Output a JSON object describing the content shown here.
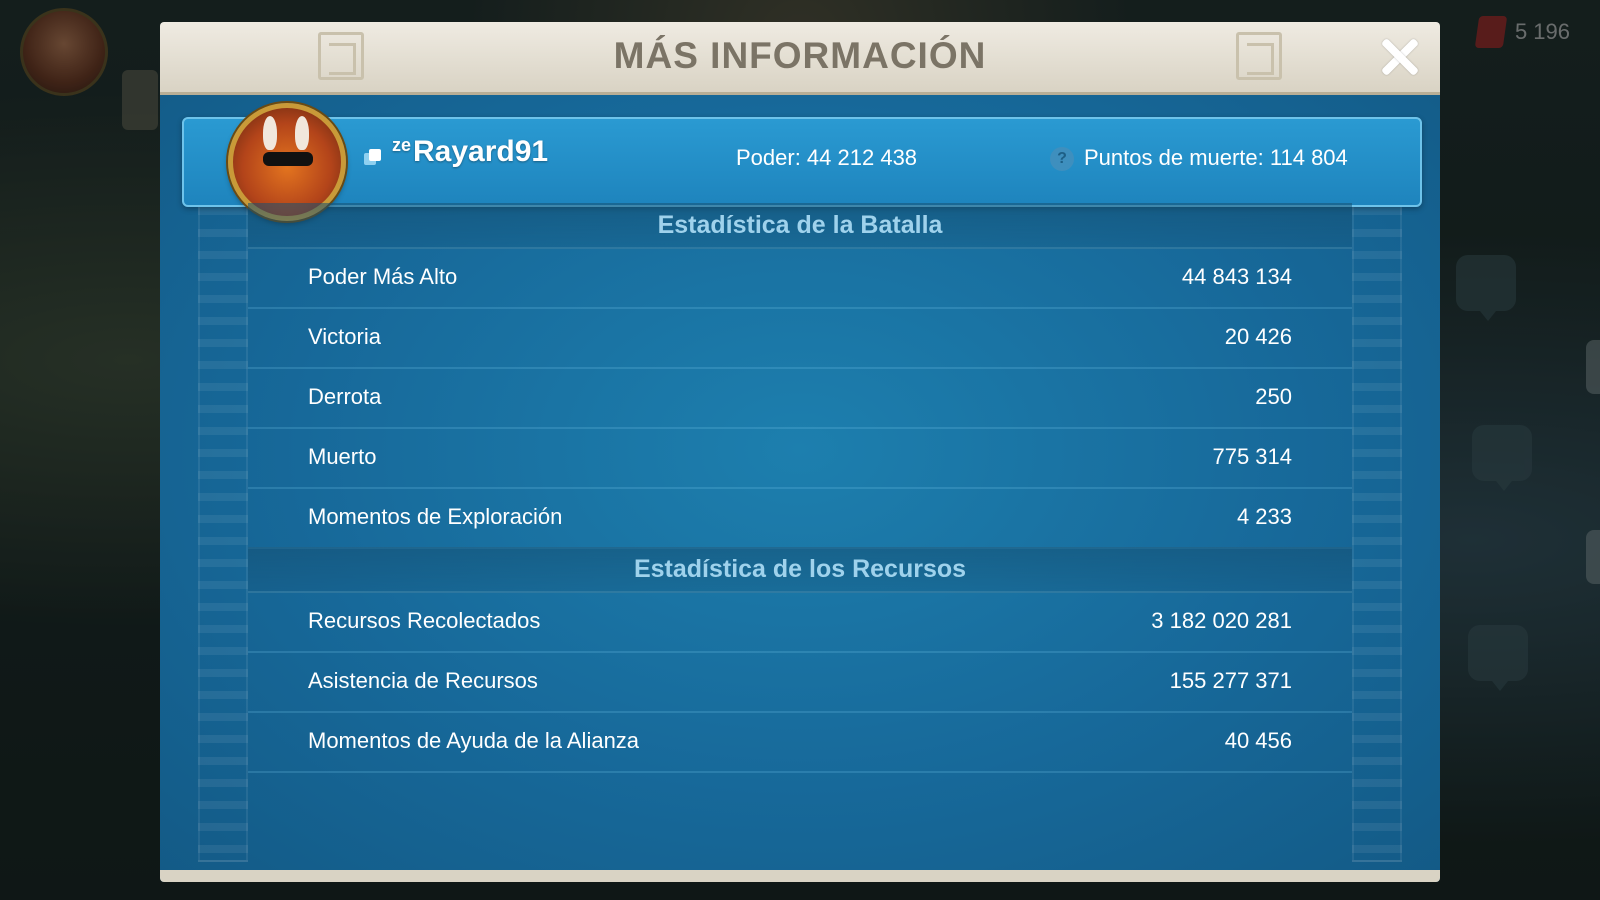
{
  "background": {
    "gem_count": "5 196"
  },
  "dialog": {
    "title": "MÁS INFORMACIÓN",
    "close_icon": "close-icon"
  },
  "profile": {
    "alliance_tag": "ze",
    "name": "Rayard91",
    "power": "Poder: 44 212 438",
    "death_points": "Puntos de muerte: 114 804",
    "help_icon": "?"
  },
  "battle_stats": {
    "header": "Estadística de la Batalla",
    "rows": [
      {
        "label": "Poder Más Alto",
        "value": "44 843 134"
      },
      {
        "label": "Victoria",
        "value": "20 426"
      },
      {
        "label": "Derrota",
        "value": "250"
      },
      {
        "label": "Muerto",
        "value": "775 314"
      },
      {
        "label": "Momentos de Exploración",
        "value": "4 233"
      }
    ]
  },
  "resource_stats": {
    "header": "Estadística de los Recursos",
    "rows": [
      {
        "label": "Recursos Recolectados",
        "value": "3 182 020 281"
      },
      {
        "label": "Asistencia de Recursos",
        "value": "155 277 371"
      },
      {
        "label": "Momentos de Ayuda de la Alianza",
        "value": "40 456"
      }
    ]
  },
  "colors": {
    "panel_blue": "#1d7fae",
    "header_cream": "#efebe2",
    "title_gray": "#7b7466",
    "section_text": "#9fd2ec"
  }
}
